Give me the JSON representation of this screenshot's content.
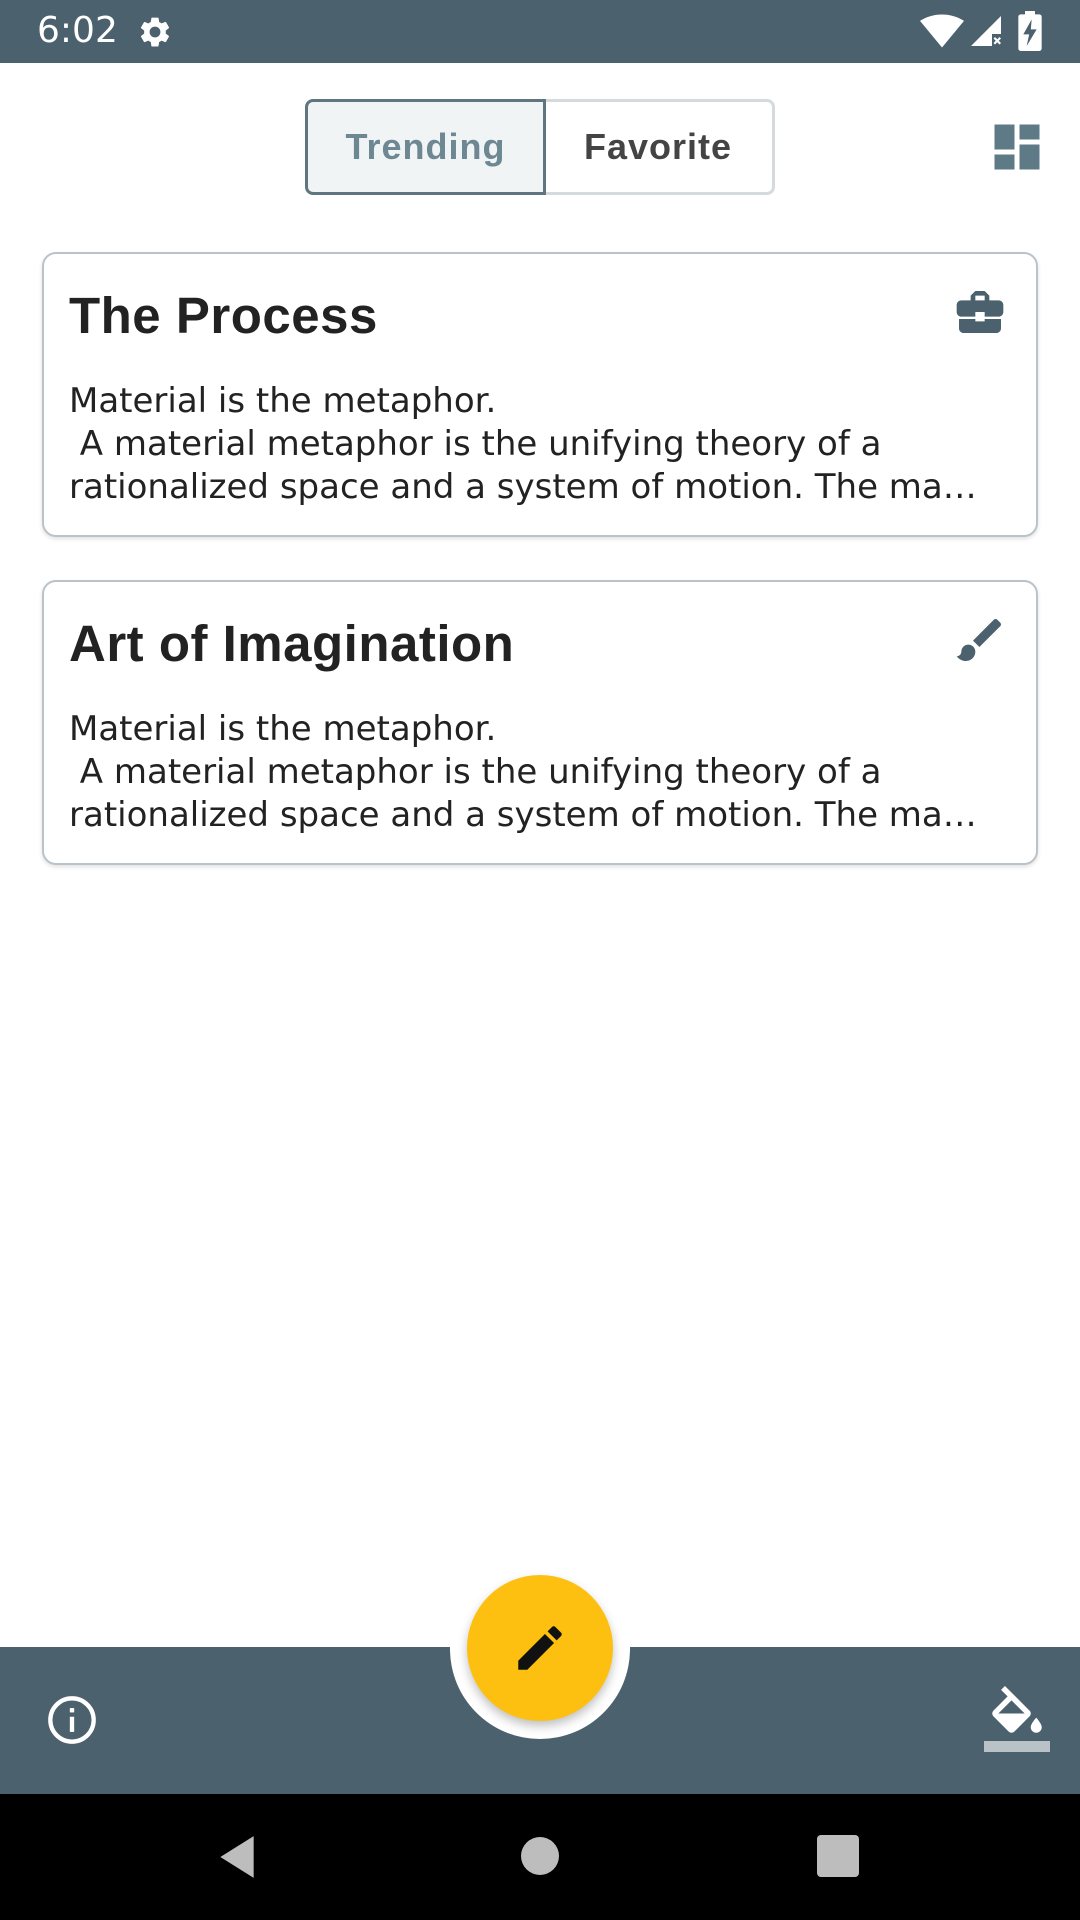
{
  "status_bar": {
    "time": "6:02"
  },
  "tabs": {
    "trending_label": "Trending",
    "favorite_label": "Favorite",
    "selected": "Trending"
  },
  "cards": [
    {
      "title": "The Process",
      "icon": "briefcase-icon",
      "body_lines": [
        "Material is the metaphor.",
        " A material metaphor is the unifying theory of a",
        "rationalized space and a system of motion. The ma…"
      ]
    },
    {
      "title": "Art of Imagination",
      "icon": "brush-icon",
      "body_lines": [
        "Material is the metaphor.",
        " A material metaphor is the unifying theory of a",
        "rationalized space and a system of motion. The ma…"
      ]
    }
  ],
  "bottom_bar": {
    "left_icon": "info-icon",
    "fab_icon": "pencil-icon",
    "right_icon": "format-color-fill-icon"
  },
  "colors": {
    "primary": "#4b616d",
    "accent": "#fdc010",
    "card_border": "#b9c3c9"
  }
}
